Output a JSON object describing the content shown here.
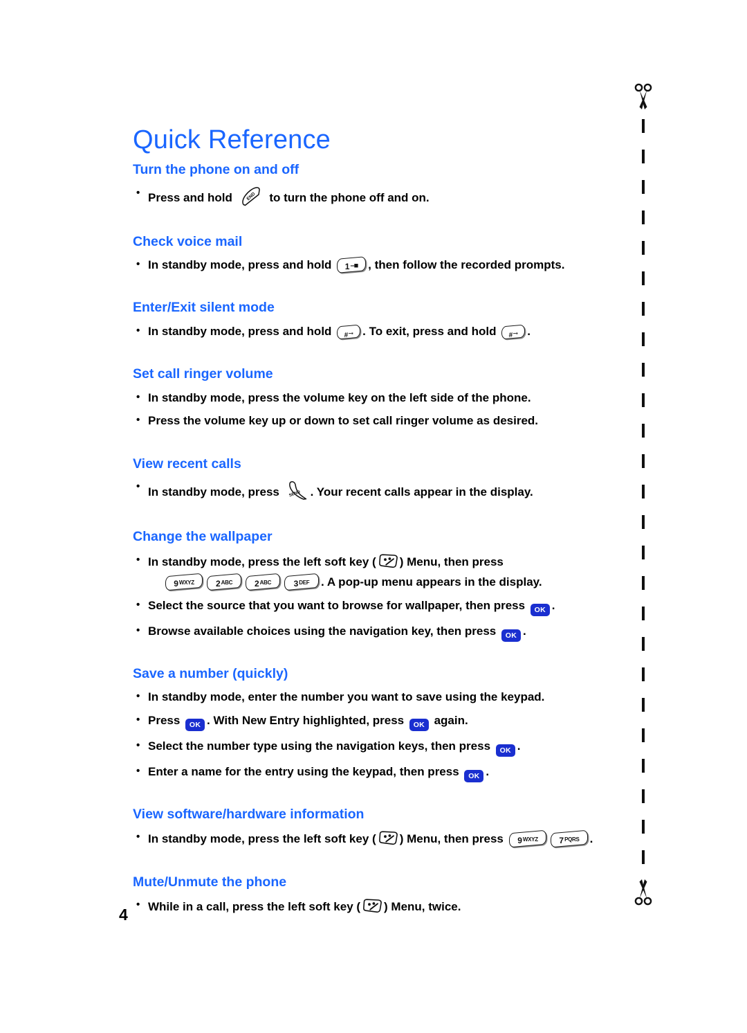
{
  "document": {
    "title": "Quick Reference",
    "page_number": "4",
    "title_color": "#1a66ff",
    "heading_color": "#1a66ff",
    "ok_key_color": "#1a2fd0"
  },
  "sections": [
    {
      "id": "turn-phone-on-off",
      "heading": "Turn the phone on and off",
      "lines": [
        {
          "parts": [
            {
              "type": "text",
              "text": "Press and hold "
            },
            {
              "type": "end-key",
              "label": "END"
            },
            {
              "type": "text",
              "text": " to turn the phone off and on."
            }
          ]
        }
      ]
    },
    {
      "id": "check-voice-mail",
      "heading": "Check voice mail",
      "lines": [
        {
          "parts": [
            {
              "type": "text",
              "text": "In standby mode, press and hold "
            },
            {
              "type": "keypad-key",
              "num": "1",
              "letters": "–■"
            },
            {
              "type": "text",
              "text": ", then follow the recorded prompts."
            }
          ]
        }
      ]
    },
    {
      "id": "enter-exit-silent-mode",
      "heading": "Enter/Exit silent mode",
      "lines": [
        {
          "parts": [
            {
              "type": "text",
              "text": "In standby mode, press and hold "
            },
            {
              "type": "keypad-key",
              "num": "#",
              "letters": "–▪"
            },
            {
              "type": "text",
              "text": ". To exit, press and hold "
            },
            {
              "type": "keypad-key",
              "num": "#",
              "letters": "–▪"
            },
            {
              "type": "text",
              "text": "."
            }
          ]
        }
      ]
    },
    {
      "id": "set-call-ringer-volume",
      "heading": "Set call ringer volume",
      "lines": [
        {
          "parts": [
            {
              "type": "text",
              "text": "In standby mode, press the volume key on the left side of the phone."
            }
          ]
        },
        {
          "parts": [
            {
              "type": "text",
              "text": "Press the volume key up or down to set call ringer volume as desired."
            }
          ]
        }
      ]
    },
    {
      "id": "view-recent-calls",
      "heading": "View recent calls",
      "lines": [
        {
          "parts": [
            {
              "type": "text",
              "text": "In standby mode, press "
            },
            {
              "type": "send-key",
              "label": "SEND"
            },
            {
              "type": "text",
              "text": ". Your recent calls appear in the display."
            }
          ]
        }
      ]
    },
    {
      "id": "change-the-wallpaper",
      "heading": "Change the wallpaper",
      "lines": [
        {
          "parts": [
            {
              "type": "text",
              "text": "In standby mode, press the left soft key ("
            },
            {
              "type": "soft-key",
              "label": "left soft key"
            },
            {
              "type": "text",
              "text": ") Menu, then press"
            }
          ]
        },
        {
          "continuation": true,
          "parts": [
            {
              "type": "keypad-key",
              "num": "9",
              "letters": "WXYZ"
            },
            {
              "type": "keypad-key",
              "num": "2",
              "letters": "ABC"
            },
            {
              "type": "keypad-key",
              "num": "2",
              "letters": "ABC"
            },
            {
              "type": "keypad-key",
              "num": "3",
              "letters": "DEF"
            },
            {
              "type": "text",
              "text": ". A pop-up menu appears in the display."
            }
          ]
        },
        {
          "parts": [
            {
              "type": "text",
              "text": "Select the source that you want to browse for wallpaper, then press "
            },
            {
              "type": "ok-key",
              "label": "OK"
            },
            {
              "type": "text",
              "text": "."
            }
          ]
        },
        {
          "parts": [
            {
              "type": "text",
              "text": "Browse available choices using the navigation key, then press "
            },
            {
              "type": "ok-key",
              "label": "OK"
            },
            {
              "type": "text",
              "text": "."
            }
          ]
        }
      ]
    },
    {
      "id": "save-a-number-quickly",
      "heading": "Save a number (quickly)",
      "lines": [
        {
          "parts": [
            {
              "type": "text",
              "text": "In standby mode, enter the number you want to save using the keypad."
            }
          ]
        },
        {
          "parts": [
            {
              "type": "text",
              "text": "Press "
            },
            {
              "type": "ok-key",
              "label": "OK"
            },
            {
              "type": "text",
              "text": ". With New Entry highlighted, press "
            },
            {
              "type": "ok-key",
              "label": "OK"
            },
            {
              "type": "text",
              "text": " again."
            }
          ]
        },
        {
          "parts": [
            {
              "type": "text",
              "text": "Select the number type using the navigation keys, then press "
            },
            {
              "type": "ok-key",
              "label": "OK"
            },
            {
              "type": "text",
              "text": "."
            }
          ]
        },
        {
          "parts": [
            {
              "type": "text",
              "text": "Enter a name for the entry using the keypad, then press "
            },
            {
              "type": "ok-key",
              "label": "OK"
            },
            {
              "type": "text",
              "text": "."
            }
          ]
        }
      ]
    },
    {
      "id": "view-software-hardware-information",
      "heading": "View software/hardware information",
      "lines": [
        {
          "parts": [
            {
              "type": "text",
              "text": "In standby mode, press the left soft key ("
            },
            {
              "type": "soft-key",
              "label": "left soft key"
            },
            {
              "type": "text",
              "text": ") Menu, then press "
            },
            {
              "type": "keypad-key",
              "num": "9",
              "letters": "WXYZ"
            },
            {
              "type": "keypad-key",
              "num": "7",
              "letters": "PQRS"
            },
            {
              "type": "text",
              "text": "."
            }
          ]
        }
      ]
    },
    {
      "id": "mute-unmute-the-phone",
      "heading": "Mute/Unmute the phone",
      "lines": [
        {
          "parts": [
            {
              "type": "text",
              "text": "While in a call, press the left soft key ("
            },
            {
              "type": "soft-key",
              "label": "left soft key"
            },
            {
              "type": "text",
              "text": ") Menu, twice."
            }
          ]
        }
      ]
    }
  ],
  "cut_line": {
    "top_icon": "scissors-icon",
    "bottom_icon": "scissors-icon",
    "style": "dashed"
  }
}
